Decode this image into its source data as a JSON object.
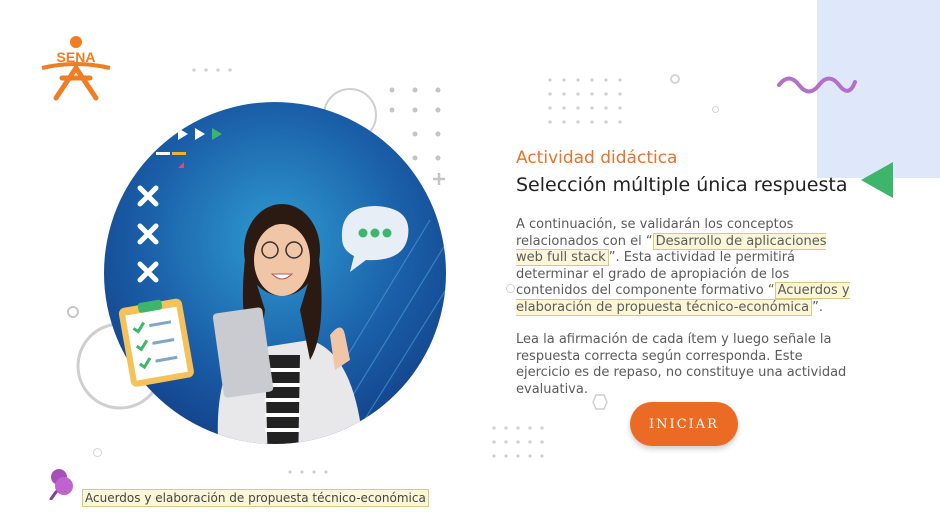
{
  "brand": {
    "name": "SENA",
    "color": "#e8732a"
  },
  "colors": {
    "accent": "#ec6b24",
    "hero_blue": "#1a5ea8",
    "triangle_green": "#3db56a",
    "wave_purple": "#b36fc9",
    "panel": "#dfe8fb"
  },
  "activity": {
    "kicker": "Actividad didáctica",
    "title": "Selección múltiple única respuesta"
  },
  "description": {
    "p1_before": "A continuación, se validarán los conceptos relacionados con el “",
    "p1_highlight_1": "Desarrollo de aplicaciones web full stack",
    "p1_middle": "”.  Esta actividad le permitirá determinar el grado de apropiación de los contenidos del componente formativo “",
    "p1_highlight_2": "Acuerdos y elaboración de propuesta técnico-económica",
    "p1_after": "”.",
    "p2": "Lea la afirmación de cada ítem y luego señale la respuesta correcta según corresponda.  Este ejercicio es de repaso, no constituye una actividad evaluativa."
  },
  "start_button": {
    "label": "INICIAR"
  },
  "footer": {
    "label": "Acuerdos y elaboración de propuesta técnico-económica",
    "icon": "pin-icon"
  },
  "hero": {
    "image": "woman-with-laptop-thumbs-up",
    "icons": [
      "checklist-icon",
      "chat-bubble-icon",
      "x-mark-icon",
      "play-arrow-icon"
    ]
  }
}
